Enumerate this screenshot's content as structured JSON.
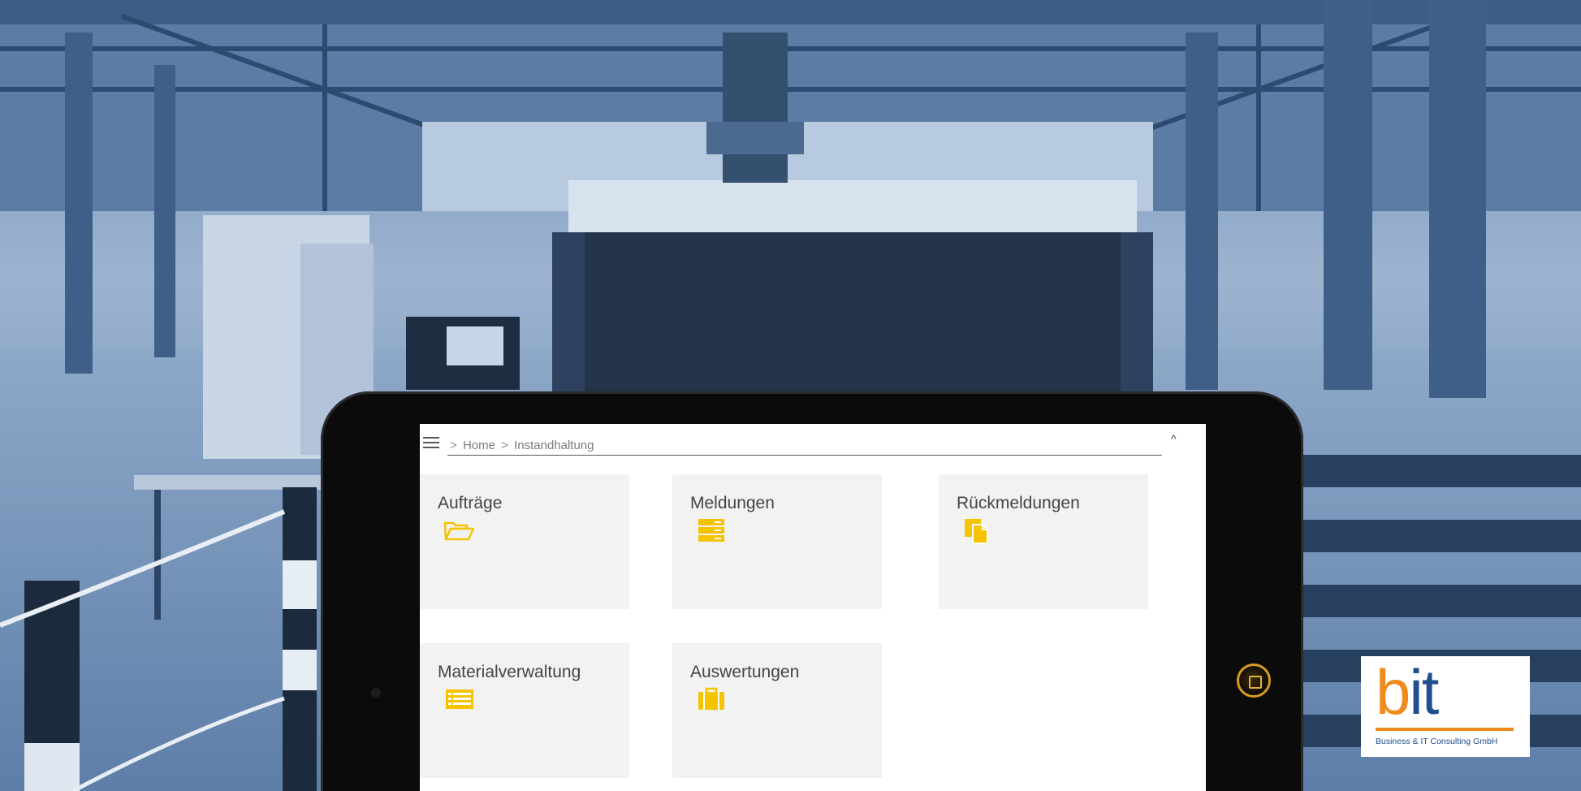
{
  "breadcrumb": {
    "prefix": ">",
    "items": [
      {
        "label": "Home"
      },
      {
        "label": "Instandhaltung"
      }
    ]
  },
  "header": {
    "menu_icon": "hamburger-menu-icon",
    "collapse_icon": "chevron-up-icon",
    "collapse_glyph": "^"
  },
  "tiles": [
    {
      "label": "Aufträge",
      "icon": "folder-open-icon"
    },
    {
      "label": "Meldungen",
      "icon": "server-stack-icon"
    },
    {
      "label": "Rückmeldungen",
      "icon": "documents-icon"
    },
    {
      "label": "Materialverwaltung",
      "icon": "list-table-icon"
    },
    {
      "label": "Auswertungen",
      "icon": "briefcase-icon"
    }
  ],
  "logo": {
    "word_b": "b",
    "word_i": "i",
    "word_t": "t",
    "subtitle": "Business & IT Consulting GmbH"
  },
  "colors": {
    "accent_yellow": "#f5c400",
    "logo_orange": "#f08a1c",
    "logo_blue": "#1f4f8f"
  }
}
